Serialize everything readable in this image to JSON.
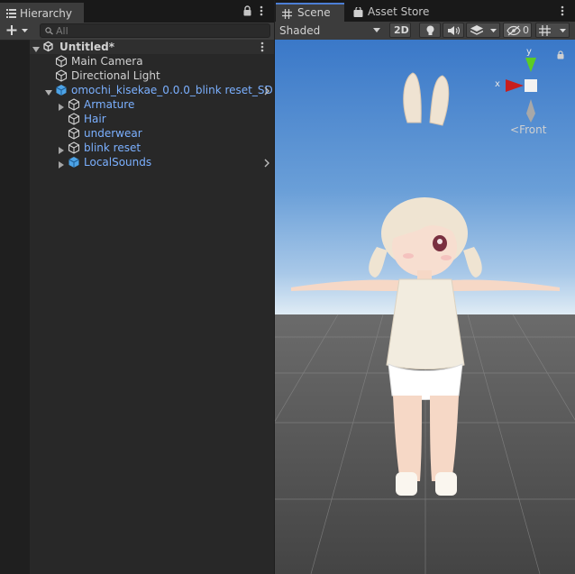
{
  "hierarchy": {
    "tab_title": "Hierarchy",
    "tab_icon": "list-icon",
    "search_placeholder": "All",
    "rows": [
      {
        "label": "Untitled*",
        "icon": "unity-scene-icon",
        "expanded": true
      },
      {
        "label": "Main Camera",
        "icon": "gameobject-cube-icon"
      },
      {
        "label": "Directional Light",
        "icon": "gameobject-cube-icon"
      },
      {
        "label": "omochi_kisekae_0.0.0_blink reset_SD",
        "icon": "prefab-icon",
        "expanded": true
      },
      {
        "label": "Armature",
        "icon": "prefab-part-icon",
        "expanded": false
      },
      {
        "label": "Hair",
        "icon": "prefab-part-icon"
      },
      {
        "label": "underwear",
        "icon": "prefab-part-icon"
      },
      {
        "label": "blink reset",
        "icon": "prefab-part-icon",
        "expanded": false
      },
      {
        "label": "LocalSounds",
        "icon": "prefab-icon",
        "expanded": false
      }
    ]
  },
  "scene": {
    "tabs": [
      {
        "label": "Scene",
        "icon": "grid-hash-icon",
        "active": true
      },
      {
        "label": "Asset Store",
        "icon": "shopping-bag-icon",
        "active": false
      }
    ],
    "toolbar": {
      "draw_mode": "Shaded",
      "mode_2d": "2D",
      "hidden_count": "0"
    },
    "gizmo": {
      "x_label": "x",
      "y_label": "y",
      "view_label": "Front"
    }
  },
  "colors": {
    "accent": "#4c7fd6",
    "prefab_text": "#7bb0ff",
    "axis_x": "#c81e1e",
    "axis_y": "#5ccd22",
    "sky_top": "#3a78c8",
    "ground": "#4b4b4b"
  }
}
